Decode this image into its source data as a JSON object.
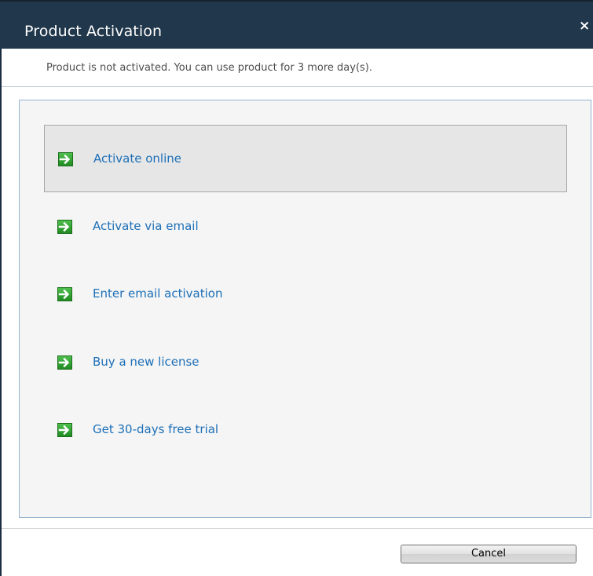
{
  "window": {
    "title": "Product Activation",
    "close_symbol": "×"
  },
  "info": {
    "message": "Product is not activated. You can use product for 3 more day(s)."
  },
  "options": [
    {
      "label": "Activate online",
      "icon": "green-arrow-right-icon",
      "selected": true
    },
    {
      "label": "Activate via email",
      "icon": "green-arrow-right-icon",
      "selected": false
    },
    {
      "label": "Enter email activation",
      "icon": "green-arrow-right-icon",
      "selected": false
    },
    {
      "label": "Buy a new license",
      "icon": "green-arrow-right-icon",
      "selected": false
    },
    {
      "label": "Get 30-days free trial",
      "icon": "green-arrow-right-icon",
      "selected": false
    }
  ],
  "footer": {
    "cancel_label": "Cancel"
  },
  "colors": {
    "titlebar": "#21374b",
    "link": "#1c6fb8",
    "arrow_green": "#2e9c2e",
    "panel_border": "#95b3cf"
  }
}
